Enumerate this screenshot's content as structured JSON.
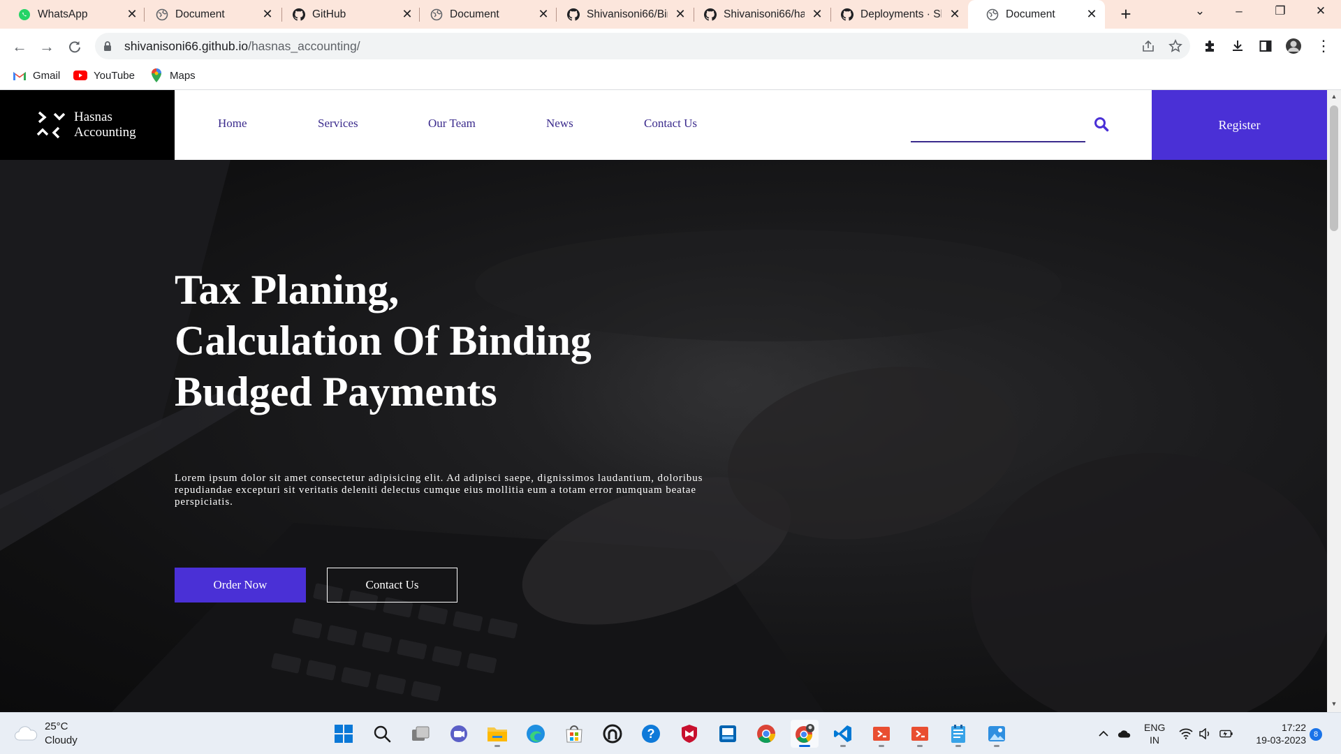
{
  "browser": {
    "tabs": [
      {
        "title": "WhatsApp",
        "favicon": "whatsapp-icon",
        "active": false
      },
      {
        "title": "Document",
        "favicon": "globe-icon",
        "active": false
      },
      {
        "title": "GitHub",
        "favicon": "github-icon",
        "active": false
      },
      {
        "title": "Document",
        "favicon": "globe-icon",
        "active": false
      },
      {
        "title": "Shivanisoni66/Bir",
        "favicon": "github-icon",
        "active": false
      },
      {
        "title": "Shivanisoni66/ha",
        "favicon": "github-icon",
        "active": false
      },
      {
        "title": "Deployments · Sh",
        "favicon": "github-icon",
        "active": false
      },
      {
        "title": "Document",
        "favicon": "globe-icon",
        "active": true
      }
    ],
    "url_host": "shivanisoni66.github.io",
    "url_path": "/hasnas_accounting/",
    "bookmarks": [
      {
        "label": "Gmail",
        "icon": "gmail-icon"
      },
      {
        "label": "YouTube",
        "icon": "youtube-icon"
      },
      {
        "label": "Maps",
        "icon": "maps-icon"
      }
    ],
    "colors": {
      "tabstrip": "#fce6dc",
      "omnibox": "#f1f3f4"
    }
  },
  "site": {
    "brand": {
      "line1": "Hasnas",
      "line2": "Accounting"
    },
    "nav": [
      "Home",
      "Services",
      "Our Team",
      "News",
      "Contact Us"
    ],
    "search_value": "",
    "register_label": "Register",
    "hero": {
      "title_lines": [
        "Tax Planing,",
        "Calculation Of Binding",
        "Budged Payments"
      ],
      "text": "Lorem ipsum dolor sit amet consectetur adipisicing elit. Ad adipisci saepe, dignissimos laudantium, doloribus repudiandae excepturi sit veritatis deleniti delectus cumque eius mollitia eum a totam error numquam beatae perspiciatis.",
      "primary_button": "Order Now",
      "secondary_button": "Contact Us"
    },
    "colors": {
      "accent": "#4a30d6",
      "nav_text": "#3a2a8c",
      "brand_bg": "#000000"
    }
  },
  "taskbar": {
    "weather": {
      "temp": "25°C",
      "condition": "Cloudy"
    },
    "apps": [
      "windows-start-icon",
      "search-icon",
      "task-view-icon",
      "chat-icon",
      "file-explorer-icon",
      "edge-icon",
      "store-icon",
      "github-desktop-icon",
      "help-icon",
      "mcafee-icon",
      "app-icon",
      "chrome-icon",
      "chrome-profile-icon",
      "vscode-icon",
      "git-icon",
      "git-icon",
      "notepad-icon",
      "photos-icon"
    ],
    "lang": {
      "line1": "ENG",
      "line2": "IN"
    },
    "time": "17:22",
    "date": "19-03-2023",
    "notifications": "8"
  }
}
